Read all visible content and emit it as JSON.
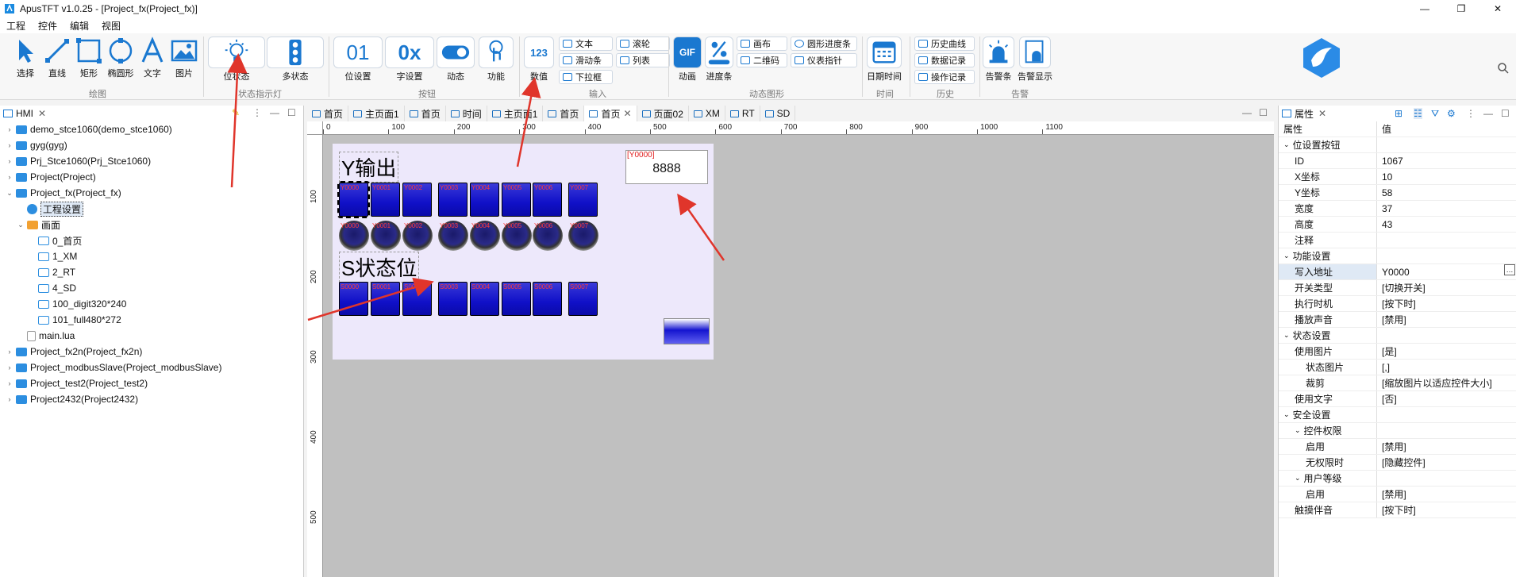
{
  "window": {
    "title": "ApusTFT v1.0.25 - [Project_fx(Project_fx)]",
    "min": "—",
    "max": "❐",
    "close": "✕"
  },
  "menu": [
    "工程",
    "控件",
    "编辑",
    "视图"
  ],
  "ribbon": {
    "draw": {
      "items": [
        "选择",
        "直线",
        "矩形",
        "椭圆形",
        "文字",
        "图片"
      ],
      "group": "绘图"
    },
    "indicator": {
      "items": [
        "位状态",
        "多状态"
      ],
      "group": "状态指示灯"
    },
    "buttons": {
      "items": [
        "位设置",
        "字设置",
        "动态",
        "功能"
      ],
      "icons": [
        "01",
        "0x"
      ],
      "group": "按钮"
    },
    "input": {
      "numeric": "数值",
      "numeric_icon": "123",
      "small": [
        "文本",
        "滚轮",
        "滑动条",
        "列表",
        "下拉框"
      ],
      "group": "输入"
    },
    "dynamic": {
      "items": [
        "动画",
        "进度条"
      ],
      "gif_icon": "GIF",
      "small": [
        "画布",
        "圆形进度条",
        "二维码",
        "仪表指针"
      ],
      "group": "动态图形"
    },
    "time": {
      "items": [
        "日期时间"
      ],
      "group": "时间"
    },
    "history": {
      "small": [
        "历史曲线",
        "数据记录",
        "操作记录"
      ],
      "group": "历史"
    },
    "alarm": {
      "items": [
        "告警条",
        "告警显示"
      ],
      "group": "告警"
    }
  },
  "left_panel": {
    "tab": "HMI",
    "tree": [
      {
        "label": "demo_stce1060(demo_stce1060)",
        "level": 0,
        "exp": "›",
        "icon": "proj"
      },
      {
        "label": "gyg(gyg)",
        "level": 0,
        "exp": "›",
        "icon": "proj"
      },
      {
        "label": "Prj_Stce1060(Prj_Stce1060)",
        "level": 0,
        "exp": "›",
        "icon": "proj"
      },
      {
        "label": "Project(Project)",
        "level": 0,
        "exp": "›",
        "icon": "proj"
      },
      {
        "label": "Project_fx(Project_fx)",
        "level": 0,
        "exp": "⌄",
        "icon": "proj"
      },
      {
        "label": "工程设置",
        "level": 1,
        "exp": "",
        "icon": "gear",
        "selected": true
      },
      {
        "label": "画面",
        "level": 1,
        "exp": "⌄",
        "icon": "fold"
      },
      {
        "label": "0_首页",
        "level": 2,
        "exp": "",
        "icon": "page"
      },
      {
        "label": "1_XM",
        "level": 2,
        "exp": "",
        "icon": "page"
      },
      {
        "label": "2_RT",
        "level": 2,
        "exp": "",
        "icon": "page"
      },
      {
        "label": "4_SD",
        "level": 2,
        "exp": "",
        "icon": "page"
      },
      {
        "label": "100_digit320*240",
        "level": 2,
        "exp": "",
        "icon": "page"
      },
      {
        "label": "101_full480*272",
        "level": 2,
        "exp": "",
        "icon": "page"
      },
      {
        "label": "main.lua",
        "level": 1,
        "exp": "",
        "icon": "doc"
      },
      {
        "label": "Project_fx2n(Project_fx2n)",
        "level": 0,
        "exp": "›",
        "icon": "proj"
      },
      {
        "label": "Project_modbusSlave(Project_modbusSlave)",
        "level": 0,
        "exp": "›",
        "icon": "proj"
      },
      {
        "label": "Project_test2(Project_test2)",
        "level": 0,
        "exp": "›",
        "icon": "proj"
      },
      {
        "label": "Project2432(Project2432)",
        "level": 0,
        "exp": "›",
        "icon": "proj"
      }
    ]
  },
  "editor": {
    "tabs": [
      "首页",
      "主页面1",
      "首页",
      "时间",
      "主页面1",
      "首页",
      "首页",
      "页面02",
      "XM",
      "RT",
      "SD"
    ],
    "active_tab": 6,
    "hruler": [
      "0",
      "100",
      "200",
      "300",
      "400",
      "500",
      "600",
      "700",
      "800",
      "900",
      "1000",
      "1100"
    ],
    "vruler": [
      "100",
      "200",
      "300",
      "400",
      "500"
    ],
    "canvas": {
      "y_title": "Y输出",
      "s_title": "S状态位",
      "y_tags": [
        "Y0000",
        "Y0001",
        "Y0002",
        "Y0003",
        "Y0004",
        "Y0005",
        "Y0006",
        "Y0007"
      ],
      "lamp_tags": [
        "Y0000",
        "Y0001",
        "Y0002",
        "Y0003",
        "Y0004",
        "Y0005",
        "Y0006",
        "Y0007"
      ],
      "s_tags": [
        "S0000",
        "S0001",
        "S0002",
        "S0003",
        "S0004",
        "S0005",
        "S0006",
        "S0007"
      ],
      "num_tag": "[Y0000]",
      "num_value": "8888"
    }
  },
  "right_panel": {
    "tab": "属性",
    "header": [
      "属性",
      "值"
    ],
    "rows": [
      {
        "k": "位设置按钮",
        "v": "",
        "level": 0,
        "cat": true
      },
      {
        "k": "ID",
        "v": "1067",
        "level": 1
      },
      {
        "k": "X坐标",
        "v": "10",
        "level": 1
      },
      {
        "k": "Y坐标",
        "v": "58",
        "level": 1
      },
      {
        "k": "宽度",
        "v": "37",
        "level": 1
      },
      {
        "k": "高度",
        "v": "43",
        "level": 1
      },
      {
        "k": "注释",
        "v": "",
        "level": 1
      },
      {
        "k": "功能设置",
        "v": "",
        "level": 0,
        "cat": true
      },
      {
        "k": "写入地址",
        "v": "Y0000",
        "level": 1,
        "hl": true
      },
      {
        "k": "开关类型",
        "v": "[切换开关]",
        "level": 1
      },
      {
        "k": "执行时机",
        "v": "[按下时]",
        "level": 1
      },
      {
        "k": "播放声音",
        "v": "[禁用]",
        "level": 1
      },
      {
        "k": "状态设置",
        "v": "",
        "level": 0,
        "cat": true
      },
      {
        "k": "使用图片",
        "v": "[是]",
        "level": 1
      },
      {
        "k": "状态图片",
        "v": "[,]",
        "level": 2
      },
      {
        "k": "裁剪",
        "v": "[缩放图片以适应控件大小]",
        "level": 2
      },
      {
        "k": "使用文字",
        "v": "[否]",
        "level": 1
      },
      {
        "k": "安全设置",
        "v": "",
        "level": 0,
        "cat": true
      },
      {
        "k": "控件权限",
        "v": "",
        "level": 1,
        "cat": true
      },
      {
        "k": "启用",
        "v": "[禁用]",
        "level": 2
      },
      {
        "k": "无权限时",
        "v": "[隐藏控件]",
        "level": 2
      },
      {
        "k": "用户等级",
        "v": "",
        "level": 1,
        "cat": true
      },
      {
        "k": "启用",
        "v": "[禁用]",
        "level": 2
      },
      {
        "k": "触摸伴音",
        "v": "[按下时]",
        "level": 1
      }
    ]
  },
  "accent": "#1a78d0",
  "arrow_color": "#e0352b"
}
